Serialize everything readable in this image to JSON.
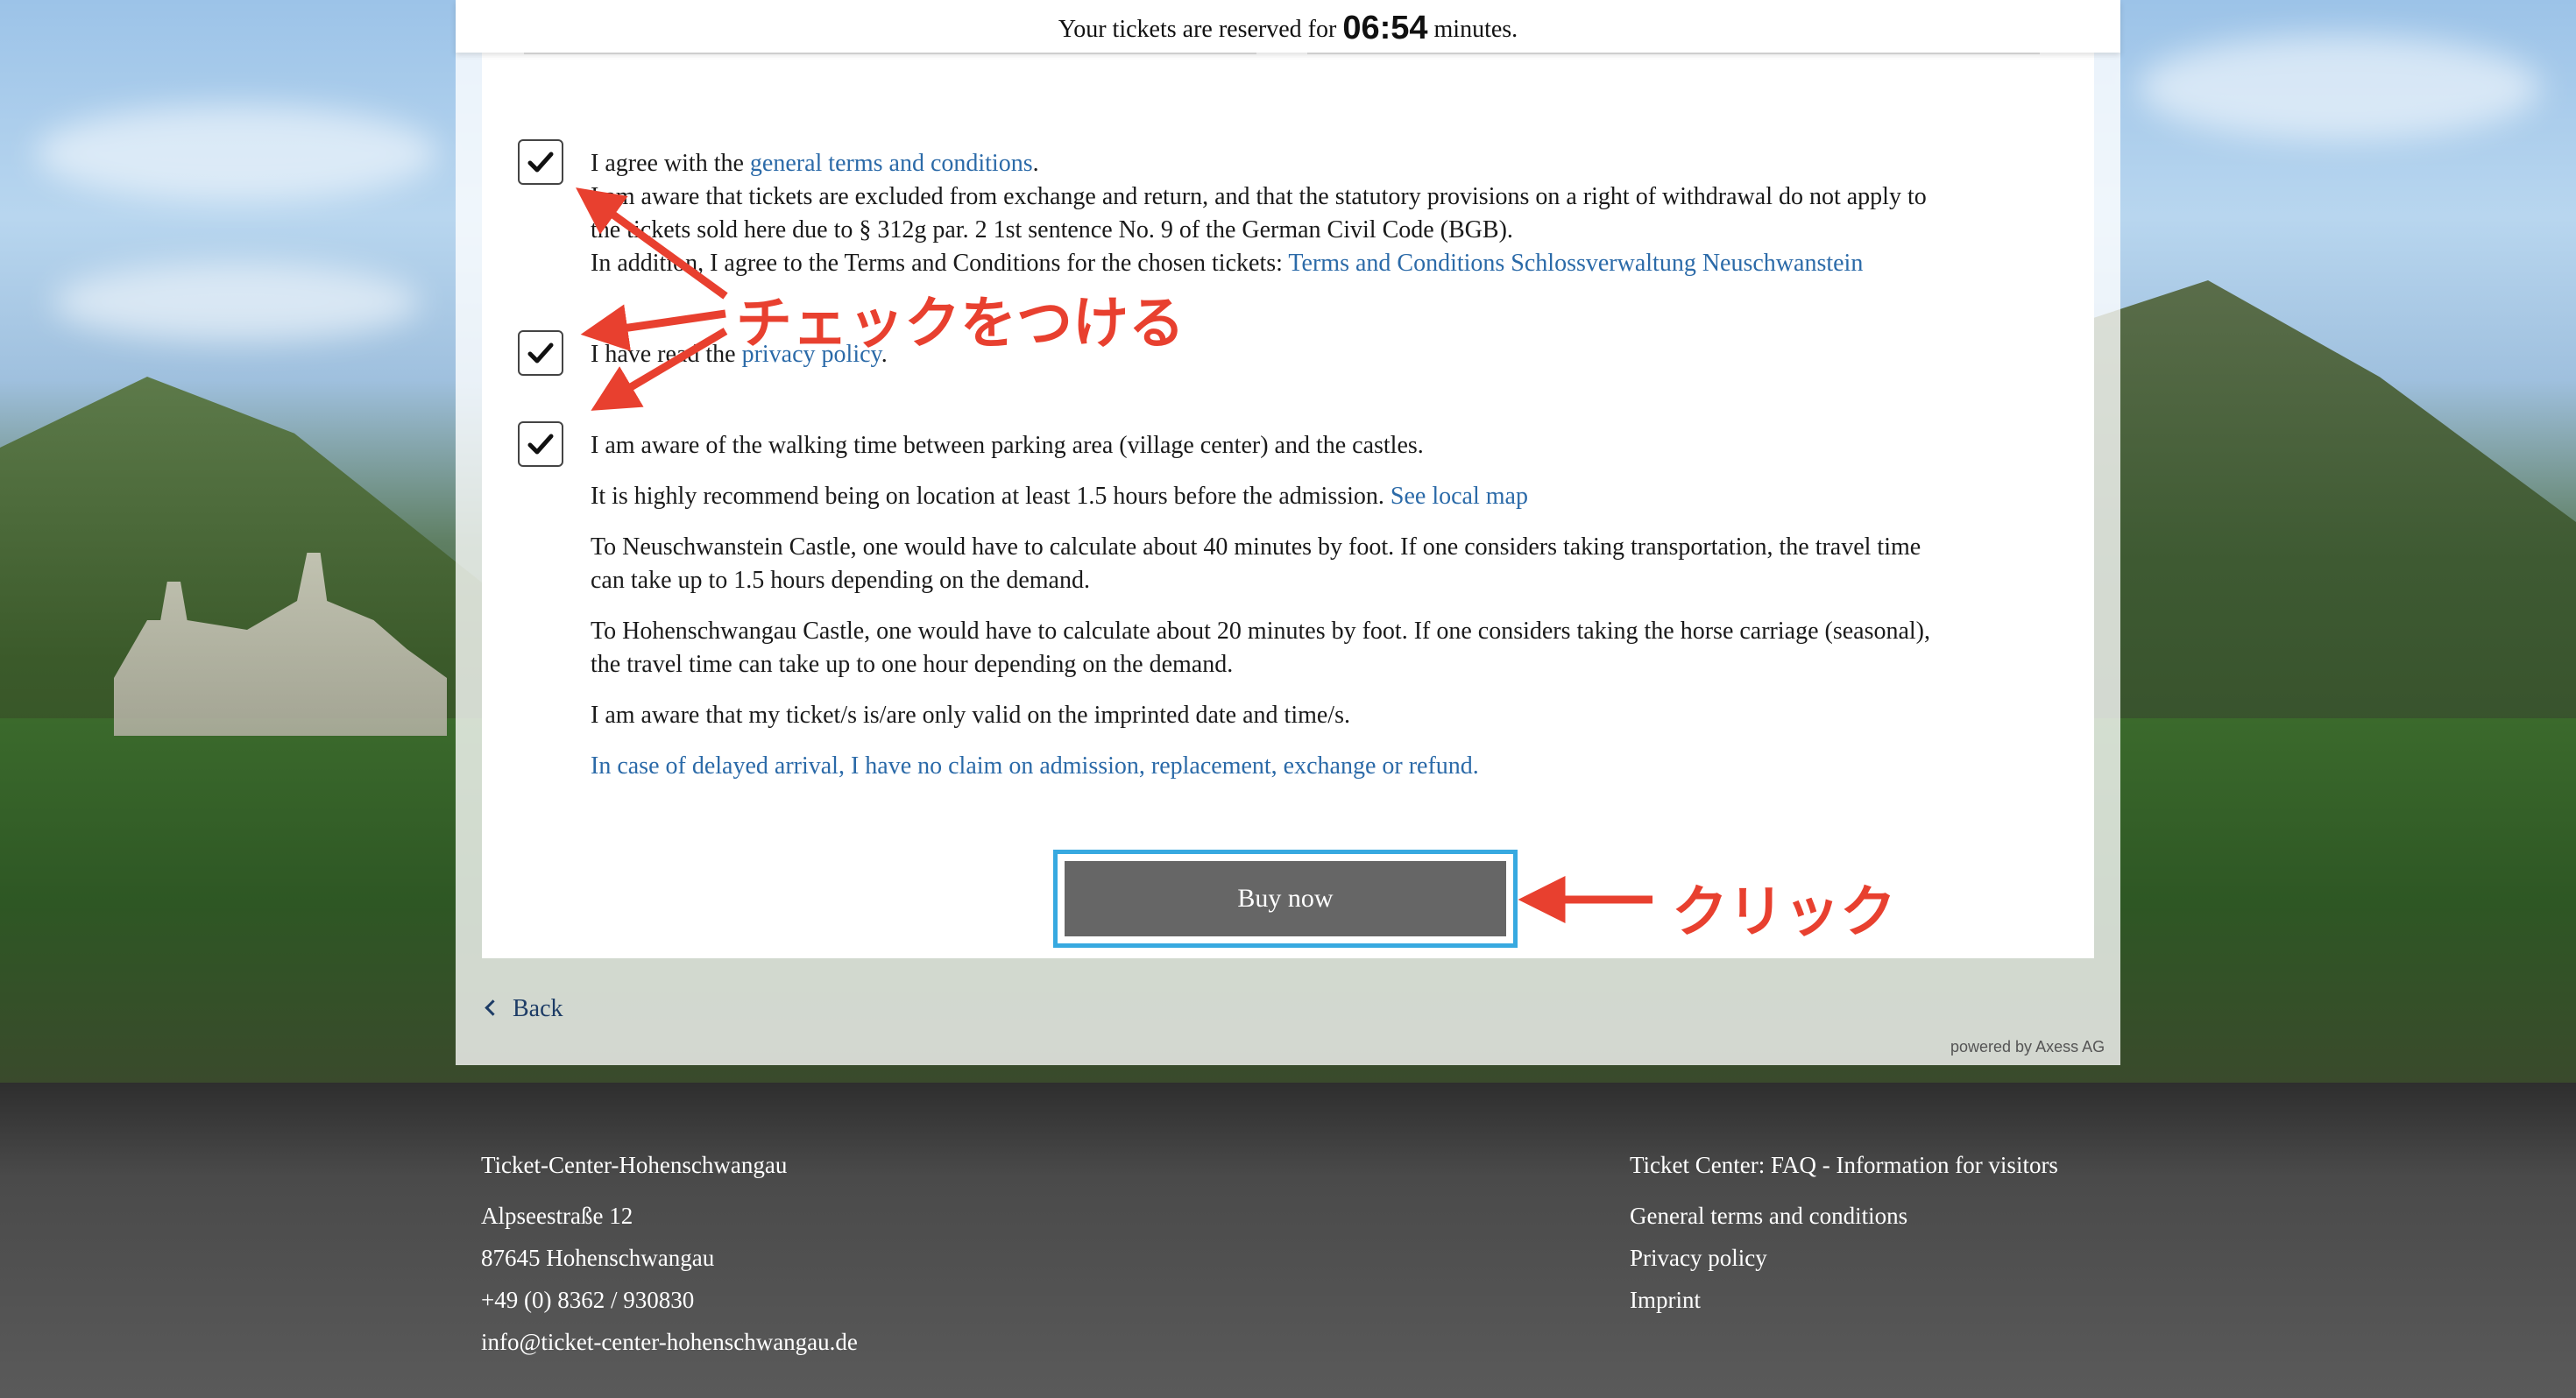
{
  "timer": {
    "prefix": "Your tickets are reserved for ",
    "time": "06:54",
    "suffix": " minutes."
  },
  "consent": {
    "terms": {
      "checked": true,
      "line1_prefix": "I agree with the ",
      "line1_link": "general terms and conditions",
      "line1_suffix": ".",
      "line2": "I am aware that tickets are excluded from exchange and return, and that the statutory provisions on a right of withdrawal do not apply to",
      "line3": "the tickets sold here due to § 312g par. 2 1st sentence No. 9 of the German Civil Code (BGB).",
      "line4_prefix": "In addition, I agree to the Terms and Conditions for the chosen tickets: ",
      "line4_link": "Terms and Conditions Schlossverwaltung Neuschwanstein"
    },
    "privacy": {
      "checked": true,
      "prefix": "I have read the ",
      "link": "privacy policy",
      "suffix": "."
    },
    "walking": {
      "checked": true,
      "p1": "I am aware of the walking time between parking area (village center) and the castles.",
      "p2_prefix": "It is highly recommend being on location at least 1.5 hours before the admission. ",
      "p2_link": "See local map",
      "p3_line1": "To Neuschwanstein Castle, one would have to calculate about 40 minutes by foot. If one considers taking transportation, the travel time",
      "p3_line2": "can take up to 1.5 hours depending on the demand.",
      "p4_line1": "To Hohenschwangau Castle, one would have to calculate about 20 minutes by foot. If one considers taking the horse carriage (seasonal),",
      "p4_line2": "the travel time can take up to one hour depending on the demand.",
      "p5": "I am aware that my ticket/s is/are only valid on the imprinted date and time/s.",
      "p6": "In case of delayed arrival, I have no claim on admission, replacement, exchange or refund."
    }
  },
  "buy_button": {
    "label": "Buy now"
  },
  "back_link": {
    "label": "Back"
  },
  "powered_by": "powered by Axess AG",
  "footer": {
    "left": {
      "title": "Ticket-Center-Hohenschwangau",
      "street": "Alpseestraße 12",
      "city": "87645 Hohenschwangau",
      "phone": "+49 (0) 8362 / 930830",
      "email": "info@ticket-center-hohenschwangau.de"
    },
    "right": {
      "faq": "Ticket Center: FAQ - Information for visitors",
      "terms": "General terms and conditions",
      "privacy": "Privacy policy",
      "imprint": "Imprint"
    }
  },
  "annotations": {
    "check_label": "チェックをつける",
    "click_label": "クリック",
    "color": "#e8402f"
  },
  "colors": {
    "link": "#2b6aa8",
    "button": "#666666",
    "button_highlight": "#37a9e0"
  }
}
